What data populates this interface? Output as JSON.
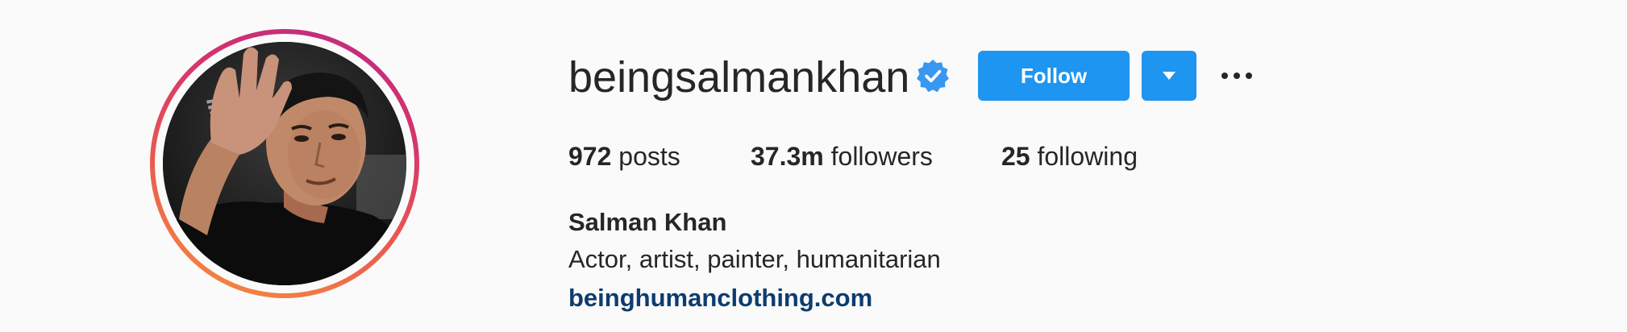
{
  "profile": {
    "username": "beingsalmankhan",
    "verified": true,
    "verified_icon": "verified-badge-icon",
    "avatar_description": "profile photo: man in black t-shirt waving with raised hand",
    "full_name": "Salman Khan",
    "bio": "Actor, artist, painter, humanitarian",
    "website": "beinghumanclothing.com"
  },
  "actions": {
    "follow_label": "Follow",
    "dropdown_icon": "caret-down-icon",
    "more_icon": "more-options-icon"
  },
  "stats": {
    "posts": {
      "count": "972",
      "label": "posts"
    },
    "followers": {
      "count": "37.3m",
      "label": "followers"
    },
    "following": {
      "count": "25",
      "label": "following"
    }
  },
  "colors": {
    "background": "#fafafa",
    "text": "#262626",
    "button_blue": "#1e95f0",
    "verified_blue": "#3897f0",
    "link": "#0d3c6e",
    "story_ring_start": "#b92a86",
    "story_ring_end": "#f5913e"
  }
}
